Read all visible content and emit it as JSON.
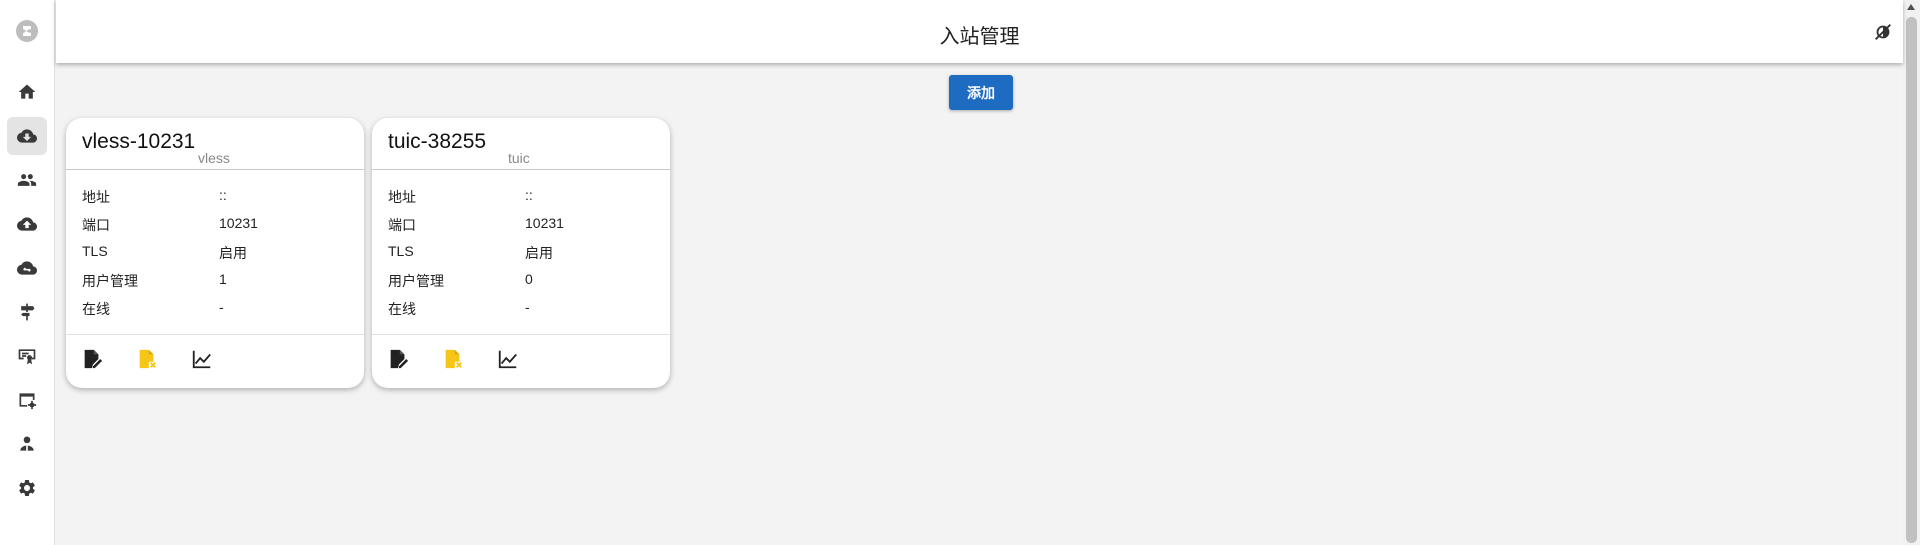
{
  "page": {
    "title": "入站管理"
  },
  "toolbar": {
    "add_label": "添加"
  },
  "sidebar": {
    "logo_icon": "singbox-logo-icon",
    "items": [
      {
        "name": "home",
        "icon": "home-icon",
        "active": false
      },
      {
        "name": "inbounds",
        "icon": "cloud-download-icon",
        "active": true
      },
      {
        "name": "users",
        "icon": "people-icon",
        "active": false
      },
      {
        "name": "outbounds",
        "icon": "cloud-upload-icon",
        "active": false
      },
      {
        "name": "endpoints",
        "icon": "cloud-sync-icon",
        "active": false
      },
      {
        "name": "rules",
        "icon": "signpost-icon",
        "active": false
      },
      {
        "name": "tls",
        "icon": "certificate-icon",
        "active": false
      },
      {
        "name": "services",
        "icon": "web-settings-icon",
        "active": false
      },
      {
        "name": "admins",
        "icon": "admin-user-icon",
        "active": false
      },
      {
        "name": "settings",
        "icon": "gear-icon",
        "active": false
      }
    ]
  },
  "theme_toggle_icon": "theme-toggle-icon",
  "cards": [
    {
      "title": "vless-10231",
      "protocol": "vless",
      "rows": [
        {
          "label": "地址",
          "value": "::"
        },
        {
          "label": "端口",
          "value": "10231"
        },
        {
          "label": "TLS",
          "value": "启用"
        },
        {
          "label": "用户管理",
          "value": "1"
        },
        {
          "label": "在线",
          "value": "-"
        }
      ],
      "actions": [
        "edit-icon",
        "delete-file-icon",
        "stats-chart-icon"
      ]
    },
    {
      "title": "tuic-38255",
      "protocol": "tuic",
      "rows": [
        {
          "label": "地址",
          "value": "::"
        },
        {
          "label": "端口",
          "value": "10231"
        },
        {
          "label": "TLS",
          "value": "启用"
        },
        {
          "label": "用户管理",
          "value": "0"
        },
        {
          "label": "在线",
          "value": "-"
        }
      ],
      "actions": [
        "edit-icon",
        "delete-file-icon",
        "stats-chart-icon"
      ]
    }
  ],
  "colors": {
    "accent": "#1e6cc2",
    "delete_icon": "#f5c518",
    "background": "#f3f3f3"
  }
}
